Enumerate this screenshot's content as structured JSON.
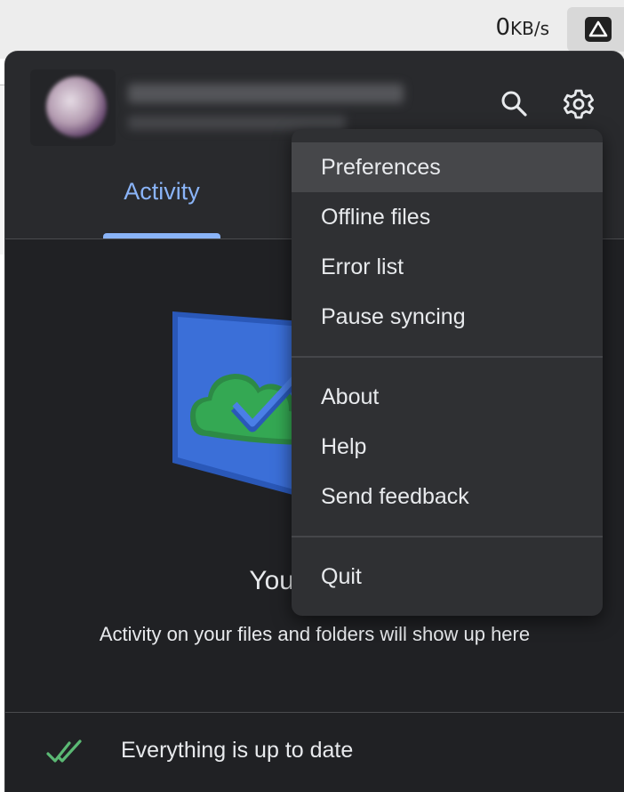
{
  "menubar": {
    "rate_value": "0",
    "rate_unit": "KB/s",
    "tray_icon": "google-drive-icon"
  },
  "account": {
    "email_blurred": "",
    "storage_blurred": ""
  },
  "header": {
    "search_icon": "search-icon",
    "settings_icon": "gear-icon"
  },
  "tabs": [
    {
      "label": "Activity",
      "selected": true
    }
  ],
  "empty_state": {
    "title": "Your files a",
    "subtitle": "Activity on your files and folders will show up here"
  },
  "footer": {
    "status": "Everything is up to date",
    "icon": "double-check-icon"
  },
  "menu": {
    "groups": [
      [
        "Preferences",
        "Offline files",
        "Error list",
        "Pause syncing"
      ],
      [
        "About",
        "Help",
        "Send feedback"
      ],
      [
        "Quit"
      ]
    ],
    "highlighted": "Preferences"
  },
  "colors": {
    "panel_bg": "#202124",
    "header_bg": "#292a2d",
    "menu_bg": "#2f3033",
    "accent": "#8ab4f8",
    "check_green": "#5bb974",
    "folder_blue": "#3b6fd8",
    "cloud_green": "#34a853"
  }
}
